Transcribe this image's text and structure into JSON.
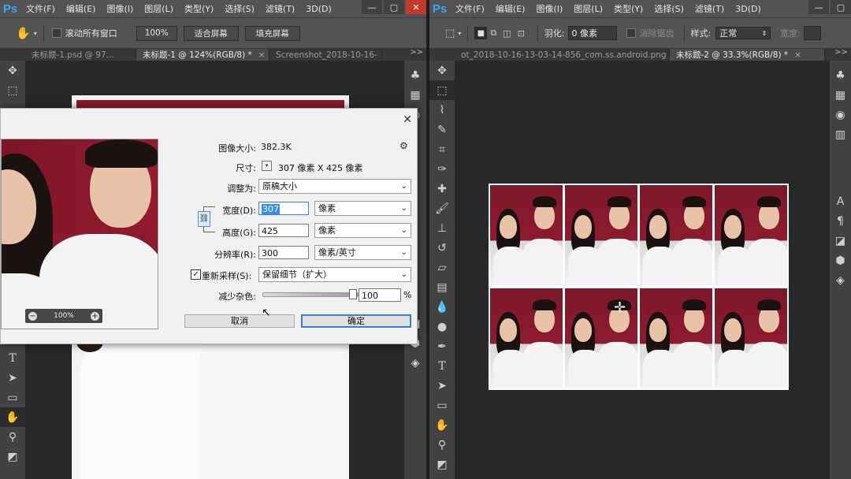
{
  "app_logo": "Ps",
  "menus": [
    "文件(F)",
    "编辑(E)",
    "图像(I)",
    "图层(L)",
    "类型(Y)",
    "选择(S)",
    "滤镜(T)",
    "3D(D)"
  ],
  "window_buttons": [
    "—",
    "▢",
    "✕"
  ],
  "left": {
    "options": {
      "scroll_all_label": "滚动所有窗口",
      "zoom_btn": "100%",
      "fit_btn": "适合屏幕",
      "fill_btn": "填充屏幕"
    },
    "tabs": [
      {
        "label": "未标题-1.psd @ 97...",
        "active": false
      },
      {
        "label": "未标题-1 @ 124%(RGB/8) *",
        "active": true
      },
      {
        "label": "Screenshot_2018-10-16-",
        "active": false
      }
    ],
    "tab_more": ">>"
  },
  "right": {
    "options": {
      "feather_label": "羽化:",
      "feather_value": "0 像素",
      "antialias_label": "消除锯齿",
      "style_label": "样式:",
      "style_value": "正常",
      "width_label": "宽度:"
    },
    "tabs": [
      {
        "label": "ot_2018-10-16-13-03-14-856_com.ss.android.png",
        "active": false
      },
      {
        "label": "未标题-2 @ 33.3%(RGB/8) *",
        "active": true
      }
    ],
    "tab_more": ">>"
  },
  "dialog": {
    "close": "✕",
    "preview_zoom": "100%",
    "image_size_label": "图像大小:",
    "image_size_value": "382.3K",
    "dimensions_label": "尺寸:",
    "dimensions_value": "307 像素  X  425 像素",
    "fit_to_label": "调整为:",
    "fit_to_value": "原稿大小",
    "width_label": "宽度(D):",
    "width_value": "307",
    "width_unit": "像素",
    "height_label": "高度(G):",
    "height_value": "425",
    "height_unit": "像素",
    "resolution_label": "分辨率(R):",
    "resolution_value": "300",
    "resolution_unit": "像素/英寸",
    "resample_label": "重新采样(S):",
    "resample_value": "保留细节（扩大）",
    "noise_label": "减少杂色:",
    "noise_value": "100",
    "noise_unit": "%",
    "cancel": "取消",
    "ok": "确定"
  }
}
